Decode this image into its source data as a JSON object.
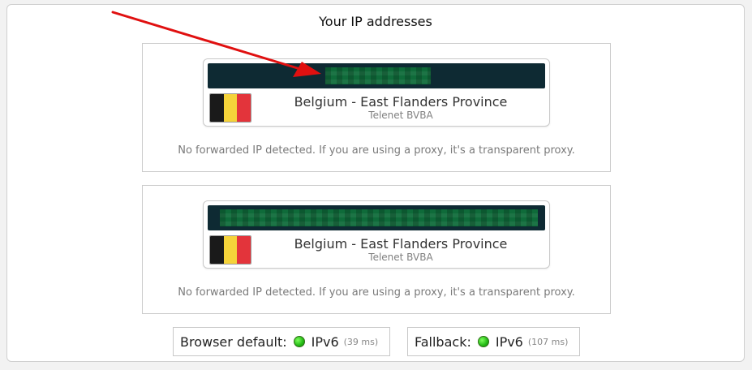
{
  "heading": "Your IP addresses",
  "panels": [
    {
      "country": "Belgium - East Flanders Province",
      "isp": "Telenet BVBA",
      "forwarded_note": "No forwarded IP detected. If you are using a proxy, it's a transparent proxy.",
      "flag": "belgium-flag-icon"
    },
    {
      "country": "Belgium - East Flanders Province",
      "isp": "Telenet BVBA",
      "forwarded_note": "No forwarded IP detected. If you are using a proxy, it's a transparent proxy.",
      "flag": "belgium-flag-icon"
    }
  ],
  "protocols": {
    "browser_default": {
      "label": "Browser default:",
      "value": "IPv6",
      "time": "(39 ms)"
    },
    "fallback": {
      "label": "Fallback:",
      "value": "IPv6",
      "time": "(107 ms)"
    }
  },
  "colors": {
    "ip_bar": "#0e2a33",
    "pixel_green": "#0f6b3a",
    "status_green": "#22b814",
    "arrow_red": "#e01010",
    "flag_black": "#1a1a1a",
    "flag_yellow": "#f5d33a",
    "flag_red": "#e3343b"
  },
  "icons": {
    "status": "status-dot-icon",
    "annotation": "red-arrow-icon"
  }
}
